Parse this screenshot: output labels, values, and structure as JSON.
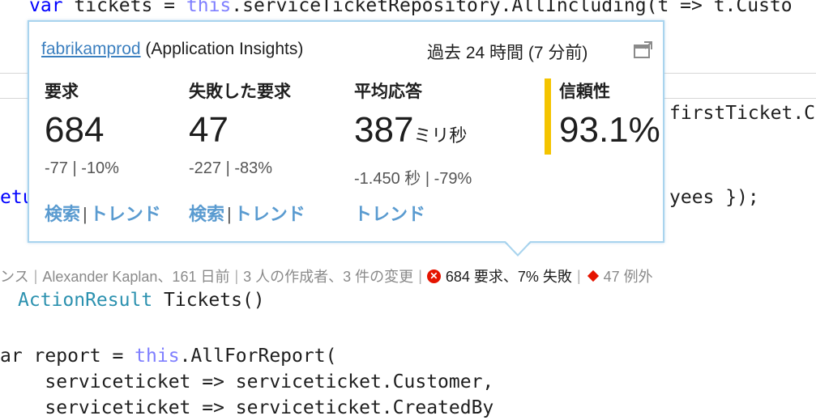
{
  "code": {
    "line_top": "var tickets = this.serviceTicketRepository.AllIncluding(t => t.Custo",
    "right_frag_1": "firstTicket.C",
    "left_frag_2": "etu",
    "right_frag_2": "yees });",
    "method_type": "ActionResult",
    "method_name": " Tickets()",
    "report_a": "ar report = ",
    "report_this": "this",
    "report_b": ".AllForReport(",
    "line_customer": "    serviceticket => serviceticket.Customer,",
    "line_createdby": "    serviceticket => serviceticket.CreatedBy"
  },
  "codelens": {
    "frag": "ンス",
    "author": "Alexander Kaplan、161 日前",
    "changes": "3 人の作成者、3 件の変更",
    "requests": "684 要求、7% 失敗",
    "exceptions": "47 例外",
    "error_icon_glyph": "✕"
  },
  "popup": {
    "app_link": "fabrikamprod",
    "app_suffix": " (Application Insights)",
    "time_range": "過去 24 時間 (7 分前)",
    "columns": {
      "requests": {
        "title": "要求",
        "value": "684",
        "delta": "-77  |  -10%"
      },
      "failed": {
        "title": "失敗した要求",
        "value": "47",
        "delta": "-227  |  -83%"
      },
      "avg": {
        "title": "平均応答",
        "value": "387",
        "unit": "ミリ秒",
        "delta": "-1.450 秒  |  -79%"
      },
      "reliability": {
        "title": "信頼性",
        "value": "93.1%"
      }
    },
    "links": {
      "search": "検索",
      "trend": "トレンド",
      "sep": "|"
    }
  },
  "colors": {
    "reliability_bar": "#f4c400",
    "link": "#5a9bd0",
    "error": "#e51400",
    "popup_border": "#a9d4ee"
  }
}
